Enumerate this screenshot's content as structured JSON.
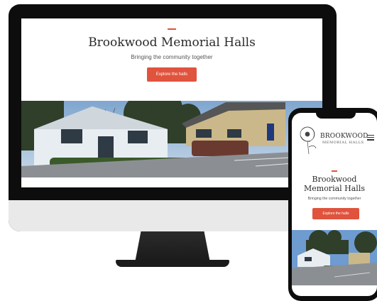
{
  "site": {
    "title": "Brookwood Memorial Halls",
    "title_line1": "Brookwood",
    "title_line2": "Memorial Halls",
    "tagline": "Bringing the community together",
    "cta_label": "Explore the halls",
    "logo_line1": "BROOKWOOD",
    "logo_line2": "MEMORIAL HALLS"
  },
  "colors": {
    "accent": "#e0533d",
    "device_frame": "#0d0d0d",
    "monitor_chin": "#e9e9e9"
  },
  "icons": {
    "menu": "hamburger-menu-icon",
    "logo": "poppy-flower-logo"
  }
}
